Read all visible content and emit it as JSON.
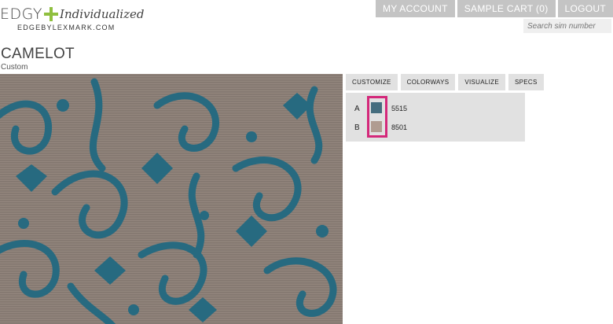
{
  "brand": {
    "edgy": "EDGY",
    "individualized": "Individualized",
    "domain": "EDGEBYLEXMARK.COM"
  },
  "topnav": {
    "account": "MY ACCOUNT",
    "cart": "SAMPLE CART (0)",
    "logout": "LOGOUT"
  },
  "search": {
    "placeholder": "Search sim number"
  },
  "product": {
    "title": "CAMELOT",
    "subtitle": "Custom"
  },
  "tabs": [
    "CUSTOMIZE",
    "COLORWAYS",
    "VISUALIZE",
    "SPECS"
  ],
  "colors": [
    {
      "letter": "A",
      "code": "5515",
      "color": "#456d7e"
    },
    {
      "letter": "B",
      "code": "8501",
      "color": "#b09c91"
    }
  ],
  "rug_colors": {
    "base": "#8c7f77",
    "pattern": "#276a80"
  },
  "highlight_color": "#d4287a"
}
